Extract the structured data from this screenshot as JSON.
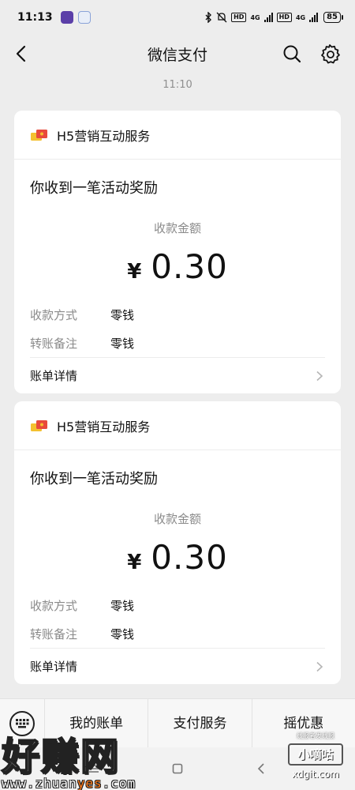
{
  "status_bar": {
    "time": "11:13",
    "network_left": "4G",
    "network_right": "4G",
    "hd": "HD",
    "battery": "85"
  },
  "header": {
    "title": "微信支付",
    "back_icon": "chevron-left-icon",
    "search_icon": "search-icon",
    "settings_icon": "gear-icon"
  },
  "timestamp": "11:10",
  "cards": [
    {
      "sender": "H5营销互动服务",
      "title": "你收到一笔活动奖励",
      "amount_label": "收款金额",
      "currency": "¥",
      "amount": "0.30",
      "rows": [
        {
          "key": "收款方式",
          "value": "零钱"
        },
        {
          "key": "转账备注",
          "value": "零钱"
        }
      ],
      "footer": "账单详情"
    },
    {
      "sender": "H5营销互动服务",
      "title": "你收到一笔活动奖励",
      "amount_label": "收款金额",
      "currency": "¥",
      "amount": "0.30",
      "rows": [
        {
          "key": "收款方式",
          "value": "零钱"
        },
        {
          "key": "转账备注",
          "value": "零钱"
        }
      ],
      "footer": "账单详情"
    }
  ],
  "tabbar": {
    "keyboard_icon": "keyboard-icon",
    "tabs": [
      "我的账单",
      "支付服务",
      "摇优惠"
    ]
  },
  "watermark": {
    "left_big": "好赚网",
    "left_url_a": "www.zhuan",
    "left_url_b": "yes",
    "left_url_c": ".com",
    "right_tag": "线报者发线报",
    "right_brand": "小嘀咕",
    "right_domain": "xdgit.com"
  },
  "colors": {
    "background": "#ededed",
    "card": "#ffffff",
    "muted_text": "#8a8a8a",
    "accent_url": "#ff7a1a"
  }
}
